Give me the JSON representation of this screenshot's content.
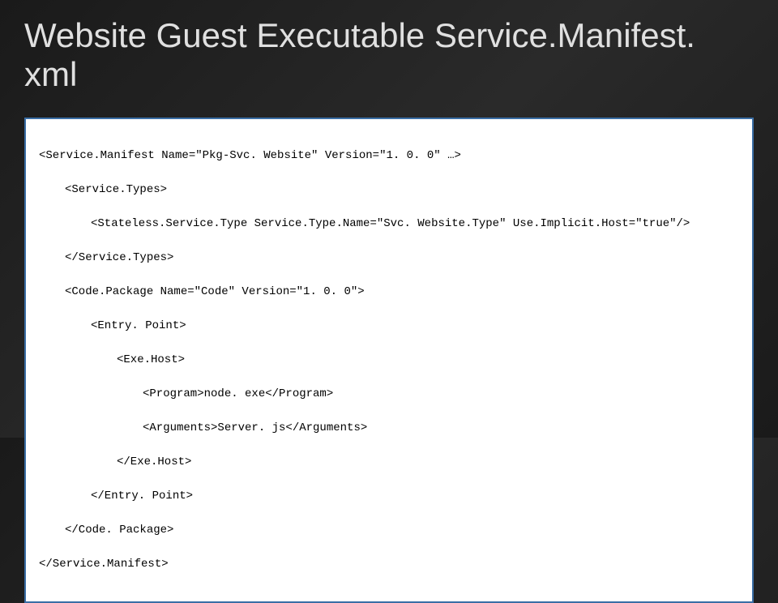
{
  "title": "Website Guest Executable Service.Manifest. xml",
  "code": {
    "l0": "<Service.Manifest Name=\"Pkg-Svc. Website\" Version=\"1. 0. 0\" …>",
    "l1": "<Service.Types>",
    "l2": "<Stateless.Service.Type Service.Type.Name=\"Svc. Website.Type\" Use.Implicit.Host=\"true\"/>",
    "l3": "</Service.Types>",
    "l4": "<Code.Package Name=\"Code\" Version=\"1. 0. 0\">",
    "l5": "<Entry. Point>",
    "l6": "<Exe.Host>",
    "l7": "<Program>node. exe</Program>",
    "l8": "<Arguments>Server. js</Arguments>",
    "l9": "</Exe.Host>",
    "l10": "</Entry. Point>",
    "l11": "</Code. Package>",
    "l12": "</Service.Manifest>"
  }
}
